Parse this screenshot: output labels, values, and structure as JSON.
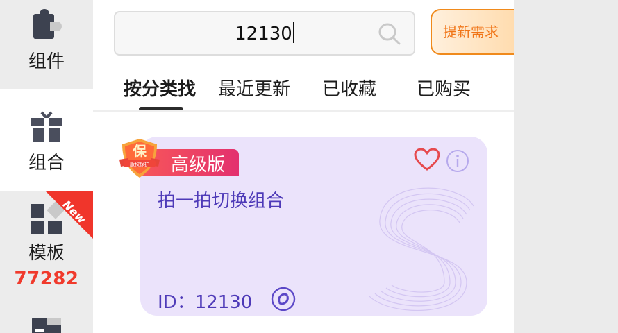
{
  "sidebar": {
    "items": [
      {
        "label": "组件",
        "icon": "puzzle-icon"
      },
      {
        "label": "组合",
        "icon": "gift-icon"
      },
      {
        "label": "模板",
        "icon": "template-grid-icon",
        "badge": "New",
        "count": "77282"
      },
      {
        "label": "",
        "icon": "folder-icon"
      }
    ]
  },
  "search": {
    "value": "12130",
    "icon": "search-icon"
  },
  "request_button": {
    "label": "提新需求"
  },
  "tabs": [
    {
      "label": "按分类找",
      "active": true
    },
    {
      "label": "最近更新"
    },
    {
      "label": "已收藏"
    },
    {
      "label": "已购买"
    }
  ],
  "card": {
    "badge_text": "保",
    "badge_subtext": "版权保护",
    "level": "高级版",
    "title": "拍一拍切换组合",
    "id_label": "ID：",
    "id_value": "12130",
    "colors": {
      "background": "#ebe3fb",
      "title": "#4e3ab8",
      "tag": "#f7565a"
    }
  },
  "colors": {
    "accent": "#f07416",
    "count": "#f03a2c"
  }
}
